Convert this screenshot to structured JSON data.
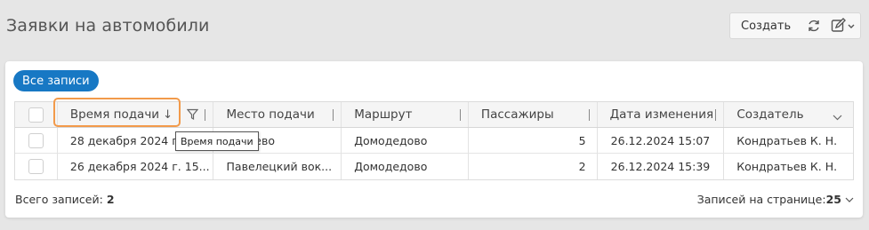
{
  "page": {
    "title": "Заявки на автомобили"
  },
  "toolbar": {
    "create_label": "Создать",
    "refresh_icon": "refresh-icon",
    "edit_icon": "edit-icon"
  },
  "filter_chip": {
    "label": "Все записи"
  },
  "table": {
    "columns": [
      "Время подачи",
      "Место подачи",
      "Маршрут",
      "Пассажиры",
      "Дата изменения",
      "Создатель"
    ],
    "sort": {
      "column": "Время подачи",
      "direction": "desc"
    },
    "rows": [
      {
        "time": "28 декабря 2024 г. ",
        "place": "метьево",
        "route": "Домодедово",
        "passengers": "5",
        "modified": "26.12.2024 15:07",
        "creator": "Кондратьев К. Н."
      },
      {
        "time": "26 декабря 2024 г. 15...",
        "place": "Павелецкий вок...",
        "route": "Домодедово",
        "passengers": "2",
        "modified": "26.12.2024 15:39",
        "creator": "Кондратьев К. Н."
      }
    ]
  },
  "tooltip": {
    "text": "Время подачи"
  },
  "footer": {
    "total_label": "Всего записей: ",
    "total_value": "2",
    "per_page_label": "Записей на странице: ",
    "per_page_value": "25"
  },
  "colors": {
    "accent": "#1778c4",
    "highlight": "#f29a4a",
    "background": "#e6e6e6"
  }
}
